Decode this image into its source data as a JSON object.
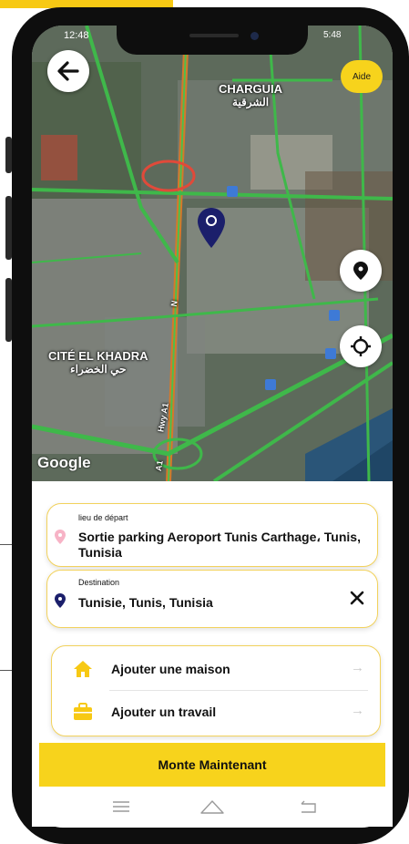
{
  "status_bar": {
    "time": "12:48",
    "right": "5:48"
  },
  "map": {
    "labels": {
      "charguia_fr": "CHARGUIA",
      "charguia_ar": "الشرقية",
      "cite_fr": "CITÉ EL KHADRA",
      "cite_ar": "حي الخضراء"
    },
    "road_labels": {
      "a1": "A1",
      "hwy": "Hwy A1",
      "n": "N"
    },
    "attribution": "Google"
  },
  "header": {
    "back_icon": "arrow-left-icon",
    "help_label": "Aide"
  },
  "map_controls": {
    "pin_icon": "location-pin-icon",
    "locate_icon": "crosshair-icon"
  },
  "departure": {
    "label": "lieu de départ",
    "value": "Sortie parking Aeroport Tunis Carthage، Tunis, Tunisia",
    "icon": "pin-icon",
    "icon_color": "#f7b3c6"
  },
  "destination": {
    "label": "Destination",
    "value": "Tunisie, Tunis, Tunisia",
    "icon": "pin-icon",
    "icon_color": "#1b1f6b",
    "clear_icon": "close-icon"
  },
  "shortcuts": [
    {
      "label": "Ajouter une maison",
      "icon": "home-icon",
      "arrow": "→"
    },
    {
      "label": "Ajouter un travail",
      "icon": "briefcase-icon",
      "arrow": "→"
    }
  ],
  "cta": {
    "label": "Monte Maintenant"
  },
  "nav_bar": {
    "menu_icon": "menu-icon",
    "home_icon": "home-nav-icon",
    "back_icon": "back-nav-icon"
  },
  "colors": {
    "accent": "#f7d31c",
    "marker": "#1b1f6b"
  }
}
